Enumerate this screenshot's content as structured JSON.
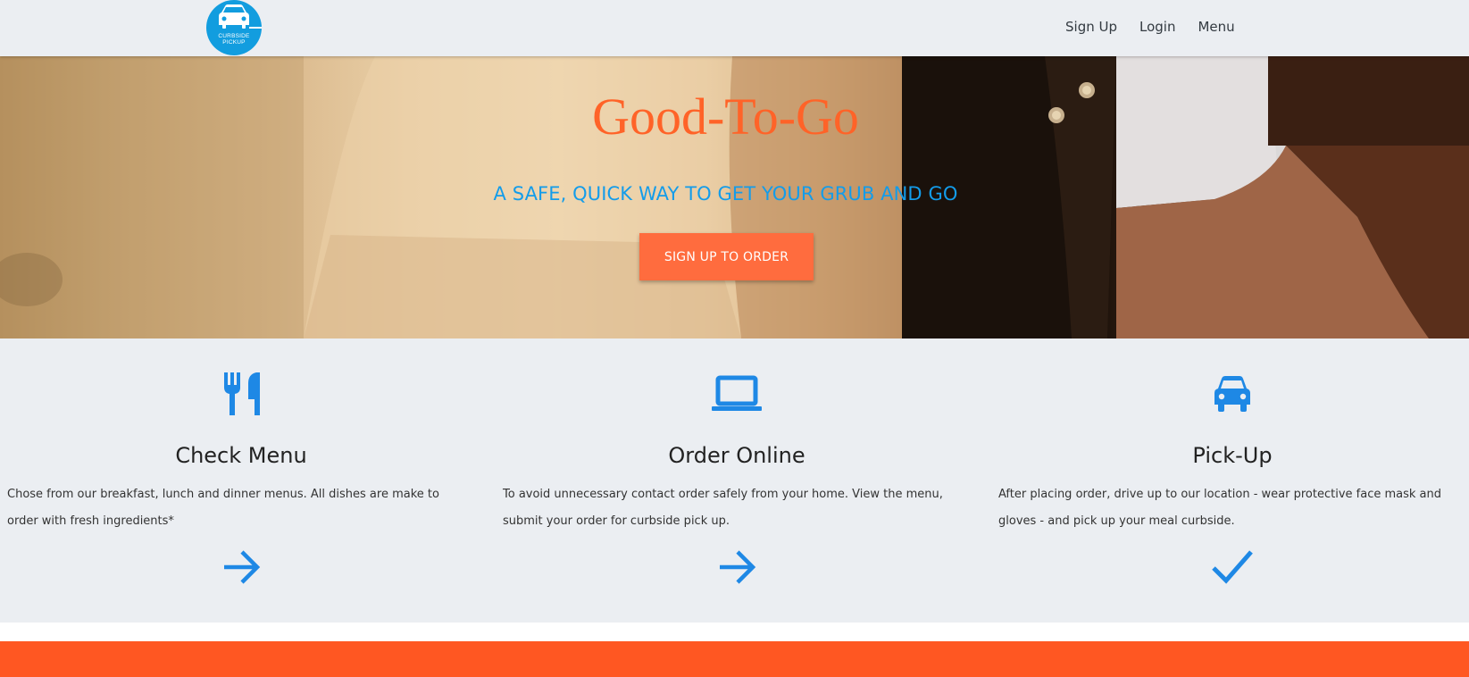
{
  "nav": {
    "logo_text_line1": "CURBSIDE",
    "logo_text_line2": "PICKUP",
    "links": [
      "Sign Up",
      "Login",
      "Menu"
    ]
  },
  "hero": {
    "title": "Good-To-Go",
    "subtitle": "A SAFE, QUICK WAY TO GET YOUR GRUB AND GO",
    "cta_label": "SIGN UP TO ORDER"
  },
  "features": [
    {
      "icon": "fork-knife-icon",
      "title": "Check Menu",
      "description": "Chose from our breakfast, lunch and dinner menus. All dishes are make to order with fresh ingredients*",
      "action_icon": "arrow-right-icon"
    },
    {
      "icon": "laptop-icon",
      "title": "Order Online",
      "description": "To avoid unnecessary contact order safely from your home. View the menu, submit your order for curbside pick up.",
      "action_icon": "arrow-right-icon"
    },
    {
      "icon": "car-icon",
      "title": "Pick-Up",
      "description": "After placing order, drive up to our location - wear protective face mask and gloves - and pick up your meal curbside.",
      "action_icon": "checkmark-icon"
    }
  ],
  "colors": {
    "accent_orange": "#ff6328",
    "accent_blue": "#139cea",
    "icon_blue": "#1e88e5",
    "bar_orange": "#ff5722",
    "background": "#ebeef2"
  }
}
